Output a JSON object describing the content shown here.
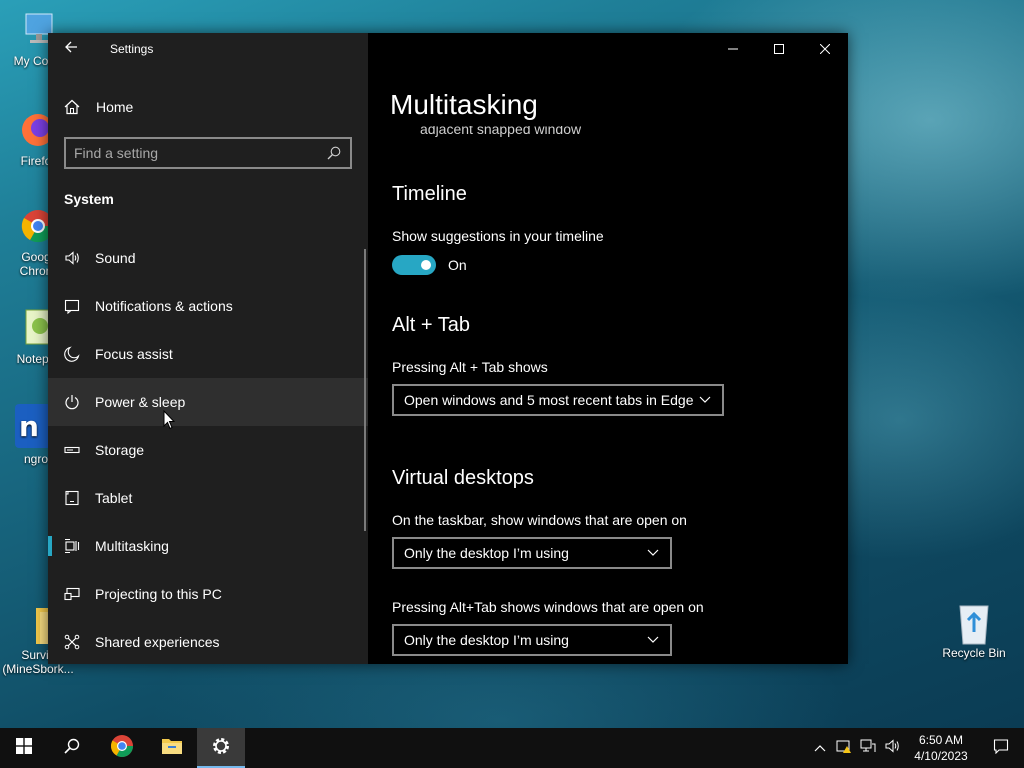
{
  "desktop": {
    "icons": [
      {
        "label": "My Com",
        "icon": "computer-icon"
      },
      {
        "label": "Firefo",
        "icon": "firefox-icon"
      },
      {
        "label": "Goog Chron",
        "icon": "chrome-icon"
      },
      {
        "label": "Notepa",
        "icon": "notepad-icon"
      },
      {
        "label": "ngro",
        "icon": "ngrok-icon"
      },
      {
        "label": "Surviv (MineSbork...",
        "icon": "folder-icon"
      },
      {
        "label": "Recycle Bin",
        "icon": "recycle-bin-icon"
      }
    ]
  },
  "window": {
    "app_title": "Settings",
    "home_label": "Home",
    "search_placeholder": "Find a setting",
    "section_title": "System",
    "nav_items": [
      {
        "label": "Sound",
        "icon": "speaker-icon"
      },
      {
        "label": "Notifications & actions",
        "icon": "notifications-icon"
      },
      {
        "label": "Focus assist",
        "icon": "moon-icon"
      },
      {
        "label": "Power & sleep",
        "icon": "power-icon"
      },
      {
        "label": "Storage",
        "icon": "storage-icon"
      },
      {
        "label": "Tablet",
        "icon": "tablet-icon"
      },
      {
        "label": "Multitasking",
        "icon": "multitasking-icon"
      },
      {
        "label": "Projecting to this PC",
        "icon": "projecting-icon"
      },
      {
        "label": "Shared experiences",
        "icon": "shared-icon"
      }
    ],
    "selected_item": "Multitasking",
    "hovered_item": "Power & sleep"
  },
  "content": {
    "page_title": "Multitasking",
    "cut_off_text": "adjacent snapped window",
    "timeline": {
      "heading": "Timeline",
      "label": "Show suggestions in your timeline",
      "toggle_state": "On"
    },
    "alt_tab": {
      "heading": "Alt + Tab",
      "label": "Pressing Alt + Tab shows",
      "value": "Open windows and 5 most recent tabs in Edge"
    },
    "virtual_desktops": {
      "heading": "Virtual desktops",
      "taskbar_label": "On the taskbar, show windows that are open on",
      "taskbar_value": "Only the desktop I’m using",
      "alttab_label": "Pressing Alt+Tab shows windows that are open on",
      "alttab_value": "Only the desktop I’m using"
    }
  },
  "taskbar": {
    "time": "6:50 AM",
    "date": "4/10/2023"
  },
  "colors": {
    "accent": "#27a7c4",
    "sidebar_bg": "#1f1f1f",
    "content_bg": "#000000",
    "taskbar_bg": "#101010"
  }
}
